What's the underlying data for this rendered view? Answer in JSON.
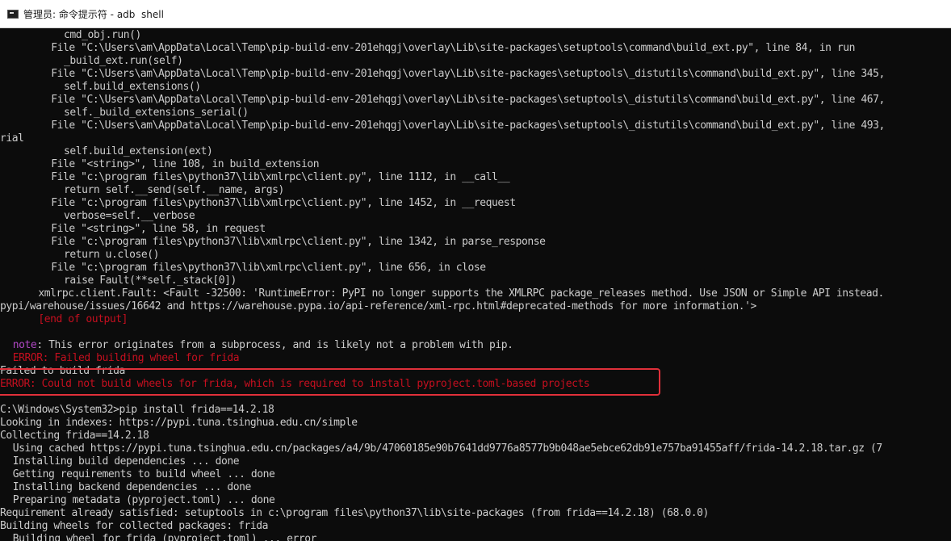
{
  "window": {
    "title": "管理员: 命令提示符 - adb  shell",
    "icon": "console-icon"
  },
  "highlight_color": "#e0303a",
  "colors": {
    "error": "#c50f1f",
    "note": "#b148c6",
    "text": "#cccccc"
  },
  "lines": [
    {
      "indent": 10,
      "segments": [
        {
          "text": "cmd_obj.run()"
        }
      ]
    },
    {
      "indent": 8,
      "segments": [
        {
          "text": "File \"C:\\Users\\am\\AppData\\Local\\Temp\\pip-build-env-201ehqgj\\overlay\\Lib\\site-packages\\setuptools\\command\\build_ext.py\", line 84, in run"
        }
      ]
    },
    {
      "indent": 10,
      "segments": [
        {
          "text": "_build_ext.run(self)"
        }
      ]
    },
    {
      "indent": 8,
      "segments": [
        {
          "text": "File \"C:\\Users\\am\\AppData\\Local\\Temp\\pip-build-env-201ehqgj\\overlay\\Lib\\site-packages\\setuptools\\_distutils\\command\\build_ext.py\", line 345,"
        }
      ]
    },
    {
      "indent": 10,
      "segments": [
        {
          "text": "self.build_extensions()"
        }
      ]
    },
    {
      "indent": 8,
      "segments": [
        {
          "text": "File \"C:\\Users\\am\\AppData\\Local\\Temp\\pip-build-env-201ehqgj\\overlay\\Lib\\site-packages\\setuptools\\_distutils\\command\\build_ext.py\", line 467,"
        }
      ]
    },
    {
      "indent": 10,
      "segments": [
        {
          "text": "self._build_extensions_serial()"
        }
      ]
    },
    {
      "indent": 8,
      "segments": [
        {
          "text": "File \"C:\\Users\\am\\AppData\\Local\\Temp\\pip-build-env-201ehqgj\\overlay\\Lib\\site-packages\\setuptools\\_distutils\\command\\build_ext.py\", line 493,"
        }
      ]
    },
    {
      "indent": 0,
      "segments": [
        {
          "text": "rial"
        }
      ]
    },
    {
      "indent": 10,
      "segments": [
        {
          "text": "self.build_extension(ext)"
        }
      ]
    },
    {
      "indent": 8,
      "segments": [
        {
          "text": "File \"<string>\", line 108, in build_extension"
        }
      ]
    },
    {
      "indent": 8,
      "segments": [
        {
          "text": "File \"c:\\program files\\python37\\lib\\xmlrpc\\client.py\", line 1112, in __call__"
        }
      ]
    },
    {
      "indent": 10,
      "segments": [
        {
          "text": "return self.__send(self.__name, args)"
        }
      ]
    },
    {
      "indent": 8,
      "segments": [
        {
          "text": "File \"c:\\program files\\python37\\lib\\xmlrpc\\client.py\", line 1452, in __request"
        }
      ]
    },
    {
      "indent": 10,
      "segments": [
        {
          "text": "verbose=self.__verbose"
        }
      ]
    },
    {
      "indent": 8,
      "segments": [
        {
          "text": "File \"<string>\", line 58, in request"
        }
      ]
    },
    {
      "indent": 8,
      "segments": [
        {
          "text": "File \"c:\\program files\\python37\\lib\\xmlrpc\\client.py\", line 1342, in parse_response"
        }
      ]
    },
    {
      "indent": 10,
      "segments": [
        {
          "text": "return u.close()"
        }
      ]
    },
    {
      "indent": 8,
      "segments": [
        {
          "text": "File \"c:\\program files\\python37\\lib\\xmlrpc\\client.py\", line 656, in close"
        }
      ]
    },
    {
      "indent": 10,
      "segments": [
        {
          "text": "raise Fault(**self._stack[0])"
        }
      ]
    },
    {
      "indent": 6,
      "segments": [
        {
          "text": "xmlrpc.client.Fault: <Fault -32500: 'RuntimeError: PyPI no longer supports the XMLRPC package_releases method. Use JSON or Simple API instead."
        }
      ]
    },
    {
      "indent": 0,
      "segments": [
        {
          "text": "pypi/warehouse/issues/16642 and https://warehouse.pypa.io/api-reference/xml-rpc.html#deprecated-methods for more information.'>"
        }
      ]
    },
    {
      "indent": 6,
      "segments": [
        {
          "text": "[end of output]",
          "color": "red"
        }
      ]
    },
    {
      "indent": 0,
      "segments": [
        {
          "text": ""
        }
      ]
    },
    {
      "indent": 2,
      "segments": [
        {
          "text": "note",
          "color": "magenta"
        },
        {
          "text": ": This error originates from a subprocess, and is likely not a problem with pip."
        }
      ]
    },
    {
      "indent": 2,
      "segments": [
        {
          "text": "ERROR: Failed building wheel for frida",
          "color": "red"
        }
      ]
    },
    {
      "indent": 0,
      "segments": [
        {
          "text": "Failed to build frida"
        }
      ]
    },
    {
      "indent": 0,
      "segments": [
        {
          "text": "ERROR: Could not build wheels for frida, which is required to install pyproject.toml-based projects",
          "color": "red"
        }
      ]
    },
    {
      "indent": 0,
      "segments": [
        {
          "text": ""
        }
      ]
    },
    {
      "indent": 0,
      "segments": [
        {
          "text": "C:\\Windows\\System32>pip install frida==14.2.18"
        }
      ]
    },
    {
      "indent": 0,
      "segments": [
        {
          "text": "Looking in indexes: https://pypi.tuna.tsinghua.edu.cn/simple"
        }
      ]
    },
    {
      "indent": 0,
      "segments": [
        {
          "text": "Collecting frida==14.2.18"
        }
      ]
    },
    {
      "indent": 2,
      "segments": [
        {
          "text": "Using cached https://pypi.tuna.tsinghua.edu.cn/packages/a4/9b/47060185e90b7641dd9776a8577b9b048ae5ebce62db91e757ba91455aff/frida-14.2.18.tar.gz (7"
        }
      ]
    },
    {
      "indent": 2,
      "segments": [
        {
          "text": "Installing build dependencies ... done"
        }
      ]
    },
    {
      "indent": 2,
      "segments": [
        {
          "text": "Getting requirements to build wheel ... done"
        }
      ]
    },
    {
      "indent": 2,
      "segments": [
        {
          "text": "Installing backend dependencies ... done"
        }
      ]
    },
    {
      "indent": 2,
      "segments": [
        {
          "text": "Preparing metadata (pyproject.toml) ... done"
        }
      ]
    },
    {
      "indent": 0,
      "segments": [
        {
          "text": "Requirement already satisfied: setuptools in c:\\program files\\python37\\lib\\site-packages (from frida==14.2.18) (68.0.0)"
        }
      ]
    },
    {
      "indent": 0,
      "segments": [
        {
          "text": "Building wheels for collected packages: frida"
        }
      ]
    },
    {
      "indent": 2,
      "segments": [
        {
          "text": "Building wheel for frida (pyproject.toml) ... error"
        }
      ]
    }
  ]
}
